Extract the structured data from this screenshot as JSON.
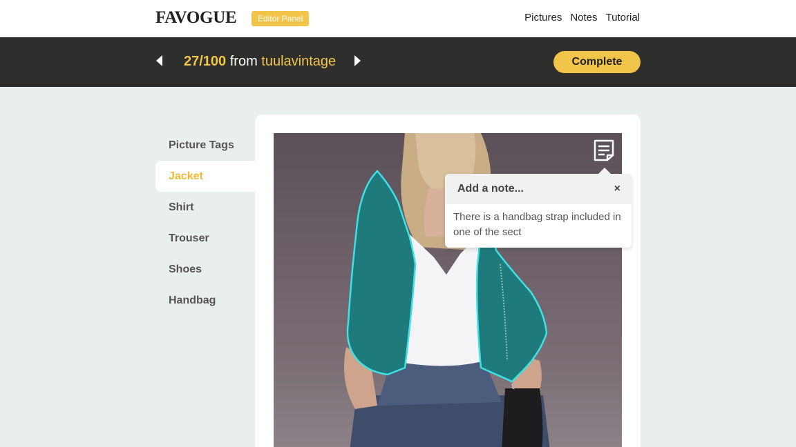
{
  "header": {
    "logo": "FAVOGUE",
    "badge": "Editor Panel",
    "nav": [
      "Pictures",
      "Notes",
      "Tutorial"
    ]
  },
  "toolbar": {
    "count": "27/100",
    "from": "from",
    "source": "tuulavintage",
    "complete_label": "Complete"
  },
  "tags": {
    "heading": "Picture Tags",
    "items": [
      "Jacket",
      "Shirt",
      "Trouser",
      "Shoes",
      "Handbag"
    ],
    "active": "Jacket"
  },
  "note": {
    "title": "Add a note...",
    "close": "×",
    "text": "There is a handbag strap included in one of the sect"
  },
  "colors": {
    "accent": "#f1c44a",
    "dark_bar": "#2e2f2d",
    "background": "#e9eeee",
    "jacket_highlight": "#1f7a7c",
    "outline": "#3fe0e6"
  }
}
